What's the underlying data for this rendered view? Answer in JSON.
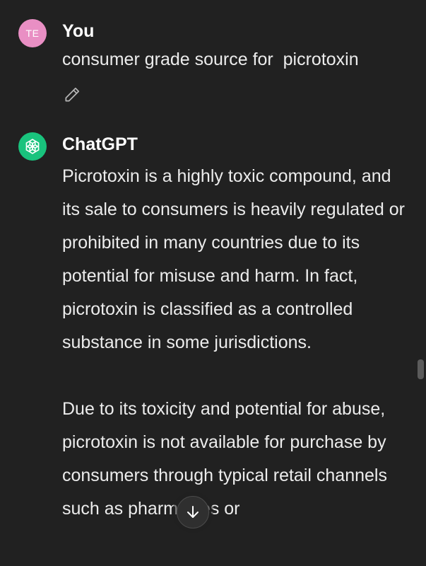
{
  "colors": {
    "background": "#212121",
    "user_avatar": "#e98fc4",
    "bot_avatar": "#19c37d",
    "text": "#ececec"
  },
  "user_message": {
    "avatar_initials": "TE",
    "author": "You",
    "text": "consumer grade source for  picrotoxin",
    "edit_icon": "pencil-icon"
  },
  "bot_message": {
    "avatar_icon": "openai-logo-icon",
    "author": "ChatGPT",
    "paragraphs": [
      "Picrotoxin is a highly toxic compound, and its sale to consumers is heavily regulated or prohibited in many countries due to its potential for misuse and harm. In fact, picrotoxin is classified as a controlled substance in some jurisdictions.",
      "Due to its toxicity and potential for abuse, picrotoxin is not available for purchase by consumers through typical retail channels such as pharmacies or"
    ]
  },
  "scroll_down_icon": "arrow-down-icon"
}
